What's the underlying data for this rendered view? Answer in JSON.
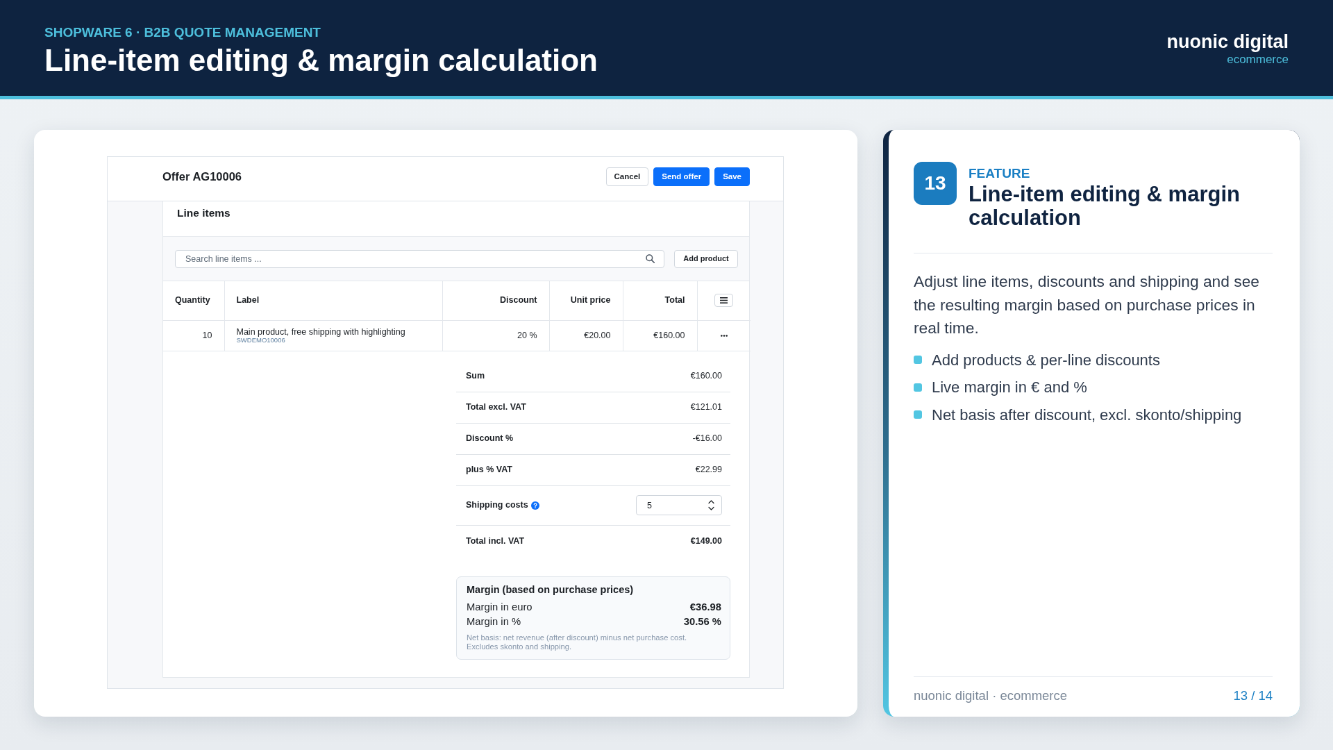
{
  "header": {
    "eyebrow": "SHOPWARE 6 · B2B QUOTE MANAGEMENT",
    "title": "Line-item editing & margin calculation",
    "brand": {
      "name": "nuonic digital",
      "tagline": "ecommerce"
    }
  },
  "screen": {
    "title": "Offer AG10006",
    "buttons": [
      {
        "label": "Cancel",
        "kind": "secondary"
      },
      {
        "label": "Send offer",
        "kind": "primary"
      },
      {
        "label": "Save",
        "kind": "primary"
      }
    ],
    "card_title": "Line items",
    "search": {
      "placeholder": "Search line items ..."
    },
    "add_button": "Add product",
    "table": {
      "columns": [
        "Quantity",
        "Label",
        "Discount",
        "Unit price",
        "Total"
      ],
      "rows": [
        {
          "quantity": "10",
          "label": "Main product, free shipping with highlighting",
          "sku": "SWDEMO10006",
          "discount": "20 %",
          "unit_price": "€20.00",
          "total": "€160.00"
        }
      ]
    },
    "summary": [
      {
        "kind": "amount",
        "label": "Sum",
        "value": "€160.00"
      },
      {
        "kind": "amount",
        "label": "Total excl. VAT",
        "value": "€121.01"
      },
      {
        "kind": "amount",
        "label": "Discount %",
        "value": "-€16.00"
      },
      {
        "kind": "amount",
        "label": "plus % VAT",
        "value": "€22.99"
      },
      {
        "kind": "input",
        "label": "Shipping costs",
        "value": "5",
        "help": true
      },
      {
        "kind": "total",
        "label": "Total incl. VAT",
        "value": "€149.00"
      }
    ],
    "margin": {
      "title": "Margin (based on purchase prices)",
      "rows": [
        {
          "label": "Margin in euro",
          "value": "€36.98"
        },
        {
          "label": "Margin in %",
          "value": "30.56 %"
        }
      ],
      "note": [
        "Net basis: net revenue (after discount) minus net purchase cost.",
        "Excludes skonto and shipping."
      ]
    }
  },
  "feature": {
    "number": "13",
    "eyebrow": "FEATURE",
    "title": "Line-item editing & margin calculation",
    "description": "Adjust line items, discounts and shipping and see the resulting margin based on purchase prices in real time.",
    "bullets": [
      "Add products & per-line discounts",
      "Live margin in € and %",
      "Net basis after discount, excl. skonto/shipping"
    ],
    "footer": {
      "brand": "nuonic digital · ecommerce",
      "page": "13 / 14"
    }
  }
}
